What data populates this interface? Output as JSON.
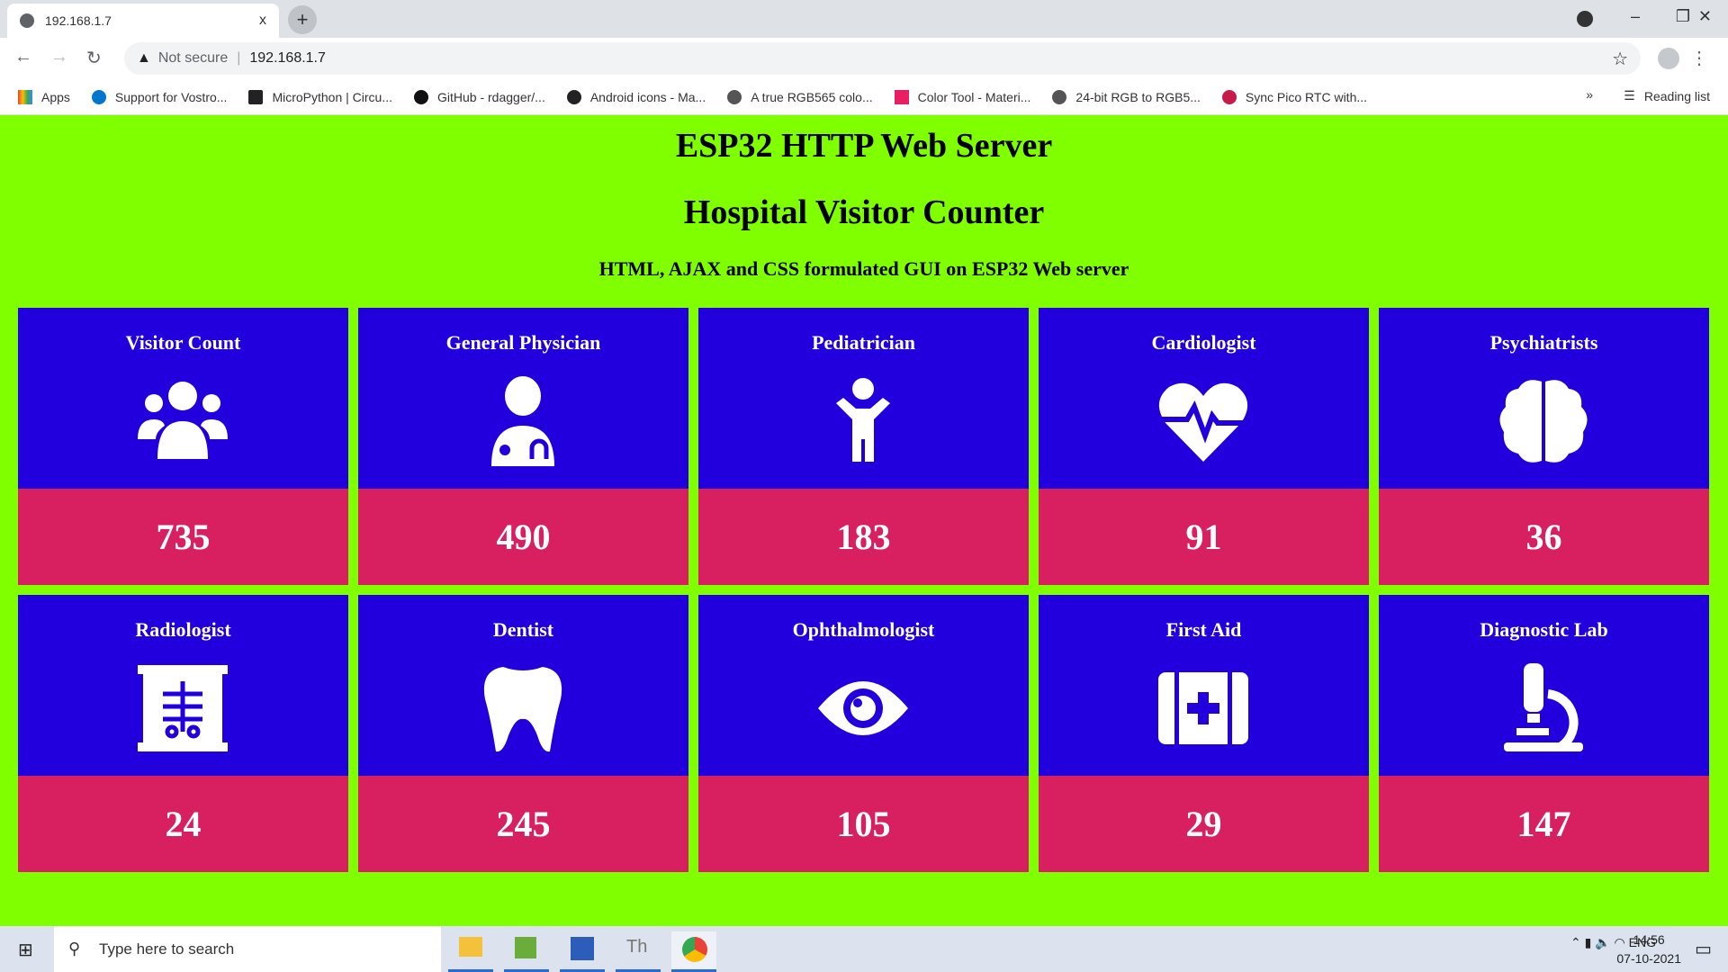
{
  "browser": {
    "tab_title": "192.168.1.7",
    "tab_close": "x",
    "new_tab": "+",
    "not_secure": "Not secure",
    "url": "192.168.1.7",
    "bookmarks": [
      "Apps",
      "Support for Vostro...",
      "MicroPython | Circu...",
      "GitHub - rdagger/...",
      "Android icons - Ma...",
      "A true RGB565 colo...",
      "Color Tool - Materi...",
      "24-bit RGB to RGB5...",
      "Sync Pico RTC with..."
    ],
    "more_bookmarks": "»",
    "reading_list": "Reading list"
  },
  "page": {
    "title": "ESP32 HTTP Web Server",
    "subtitle": "Hospital Visitor Counter",
    "caption": "HTML, AJAX and CSS formulated GUI on ESP32 Web server",
    "colors": {
      "background": "#7fff00",
      "card_top": "#2200dd",
      "card_bottom": "#d81f60"
    },
    "cards": [
      {
        "label": "Visitor Count",
        "value": "735",
        "icon": "users-icon"
      },
      {
        "label": "General Physician",
        "value": "490",
        "icon": "doctor-icon"
      },
      {
        "label": "Pediatrician",
        "value": "183",
        "icon": "child-icon"
      },
      {
        "label": "Cardiologist",
        "value": "91",
        "icon": "heartbeat-icon"
      },
      {
        "label": "Psychiatrists",
        "value": "36",
        "icon": "brain-icon"
      },
      {
        "label": "Radiologist",
        "value": "24",
        "icon": "x-ray-icon"
      },
      {
        "label": "Dentist",
        "value": "245",
        "icon": "tooth-icon"
      },
      {
        "label": "Ophthalmologist",
        "value": "105",
        "icon": "eye-icon"
      },
      {
        "label": "First Aid",
        "value": "29",
        "icon": "first-aid-icon"
      },
      {
        "label": "Diagnostic Lab",
        "value": "147",
        "icon": "microscope-icon"
      }
    ]
  },
  "taskbar": {
    "search_placeholder": "Type here to search",
    "lang": "ENG",
    "time": "14:56",
    "date": "07-10-2021"
  }
}
